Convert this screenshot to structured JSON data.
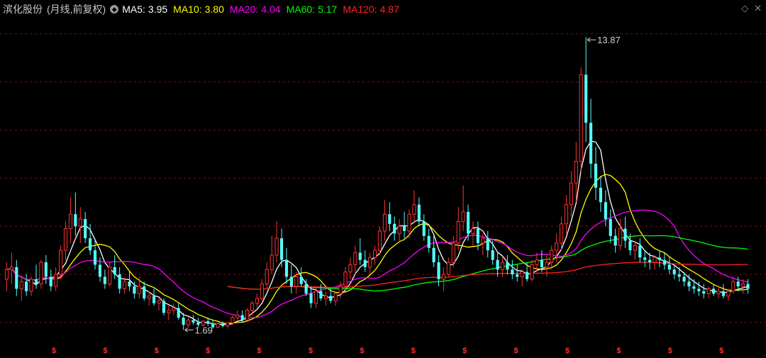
{
  "header": {
    "stock_name": "滨化股份",
    "period": "(月线,前复权)",
    "ma_items": [
      {
        "label": "MA5:",
        "value": "3.95",
        "color": "#ffffff"
      },
      {
        "label": "MA10:",
        "value": "3.80",
        "color": "#ffff00"
      },
      {
        "label": "MA20:",
        "value": "4.04",
        "color": "#ff00ff"
      },
      {
        "label": "MA60:",
        "value": "5.17",
        "color": "#00ff00"
      },
      {
        "label": "MA120:",
        "value": "4.87",
        "color": "#ff2020"
      }
    ],
    "corner_icons": [
      "diamond-icon",
      "close-icon"
    ]
  },
  "chart_data": {
    "type": "candlestick",
    "title": "滨化股份 (月线,前复权)",
    "ylim": [
      1.2,
      14.7
    ],
    "annotations": [
      {
        "text": "13.87",
        "kind": "high"
      },
      {
        "text": "1.69",
        "kind": "low"
      }
    ],
    "colors": {
      "up": "#ff3232",
      "down": "#54ffff",
      "grid": "#7a1010",
      "marker": "#ff3030"
    },
    "marker_label": "$",
    "marker_count": 14,
    "candles": [
      [
        3.8,
        4.5,
        3.3,
        4.2
      ],
      [
        4.2,
        4.9,
        3.6,
        4.3
      ],
      [
        4.3,
        4.6,
        3.1,
        3.4
      ],
      [
        3.4,
        3.9,
        2.9,
        3.7
      ],
      [
        3.7,
        4.0,
        3.1,
        3.3
      ],
      [
        3.3,
        3.9,
        3.1,
        3.8
      ],
      [
        3.8,
        4.4,
        3.4,
        3.6
      ],
      [
        3.6,
        4.6,
        3.4,
        4.5
      ],
      [
        4.5,
        4.8,
        3.6,
        3.9
      ],
      [
        3.9,
        4.2,
        3.3,
        3.5
      ],
      [
        3.5,
        4.3,
        3.3,
        4.0
      ],
      [
        4.0,
        5.2,
        3.8,
        5.0
      ],
      [
        5.0,
        6.2,
        4.6,
        5.9
      ],
      [
        5.9,
        7.2,
        5.3,
        6.5
      ],
      [
        6.5,
        7.4,
        5.6,
        6.0
      ],
      [
        6.0,
        6.8,
        5.3,
        6.3
      ],
      [
        6.3,
        6.6,
        5.3,
        5.5
      ],
      [
        5.5,
        6.1,
        4.8,
        5.0
      ],
      [
        5.0,
        5.4,
        4.2,
        4.4
      ],
      [
        4.4,
        4.7,
        3.7,
        3.9
      ],
      [
        3.9,
        4.2,
        3.4,
        3.6
      ],
      [
        3.6,
        4.5,
        3.5,
        4.3
      ],
      [
        4.3,
        4.8,
        3.8,
        4.0
      ],
      [
        4.0,
        4.3,
        3.2,
        3.4
      ],
      [
        3.4,
        3.9,
        3.2,
        3.7
      ],
      [
        3.7,
        4.1,
        3.3,
        3.5
      ],
      [
        3.5,
        3.7,
        3.0,
        3.2
      ],
      [
        3.2,
        3.9,
        3.0,
        3.5
      ],
      [
        3.5,
        3.7,
        2.9,
        3.0
      ],
      [
        3.0,
        3.3,
        2.7,
        3.1
      ],
      [
        3.1,
        3.4,
        2.7,
        2.8
      ],
      [
        2.8,
        3.0,
        2.5,
        2.9
      ],
      [
        2.9,
        3.0,
        2.3,
        2.4
      ],
      [
        2.4,
        2.7,
        2.1,
        2.5
      ],
      [
        2.5,
        2.8,
        2.3,
        2.6
      ],
      [
        2.6,
        2.8,
        2.1,
        2.2
      ],
      [
        2.2,
        2.4,
        1.69,
        1.9
      ],
      [
        1.9,
        2.2,
        1.8,
        2.1
      ],
      [
        2.1,
        2.3,
        1.9,
        2.0
      ],
      [
        2.0,
        2.2,
        1.8,
        1.9
      ],
      [
        1.9,
        2.1,
        1.8,
        2.05
      ],
      [
        2.05,
        2.2,
        1.85,
        1.95
      ],
      [
        1.95,
        2.1,
        1.75,
        1.8
      ],
      [
        1.8,
        2.0,
        1.75,
        1.95
      ],
      [
        1.95,
        2.05,
        1.8,
        1.85
      ],
      [
        1.85,
        2.0,
        1.75,
        1.98
      ],
      [
        1.98,
        2.3,
        1.9,
        2.2
      ],
      [
        2.2,
        2.5,
        2.1,
        2.3
      ],
      [
        2.3,
        2.5,
        2.0,
        2.1
      ],
      [
        2.1,
        2.6,
        2.0,
        2.5
      ],
      [
        2.5,
        2.9,
        2.3,
        2.8
      ],
      [
        2.8,
        3.2,
        2.6,
        3.0
      ],
      [
        3.0,
        3.8,
        2.9,
        3.6
      ],
      [
        3.6,
        4.5,
        3.4,
        4.2
      ],
      [
        4.2,
        5.6,
        4.0,
        4.8
      ],
      [
        4.8,
        6.2,
        4.5,
        5.5
      ],
      [
        5.5,
        5.9,
        4.3,
        4.6
      ],
      [
        4.6,
        5.1,
        3.6,
        3.9
      ],
      [
        3.9,
        4.4,
        3.2,
        3.5
      ],
      [
        3.5,
        4.1,
        3.2,
        3.9
      ],
      [
        3.9,
        4.3,
        3.5,
        3.6
      ],
      [
        3.6,
        3.8,
        3.1,
        3.2
      ],
      [
        3.2,
        3.5,
        2.6,
        2.8
      ],
      [
        2.8,
        3.5,
        2.6,
        3.3
      ],
      [
        3.3,
        3.6,
        2.9,
        3.0
      ],
      [
        3.0,
        3.3,
        2.7,
        3.1
      ],
      [
        3.1,
        3.4,
        2.8,
        2.9
      ],
      [
        2.9,
        3.3,
        2.7,
        3.2
      ],
      [
        3.2,
        3.7,
        3.0,
        3.5
      ],
      [
        3.5,
        4.3,
        3.3,
        4.1
      ],
      [
        4.1,
        4.7,
        3.8,
        4.4
      ],
      [
        4.4,
        5.2,
        4.0,
        4.9
      ],
      [
        4.9,
        5.5,
        4.4,
        4.6
      ],
      [
        4.6,
        5.0,
        4.1,
        4.3
      ],
      [
        4.3,
        4.9,
        4.0,
        4.7
      ],
      [
        4.7,
        5.2,
        4.4,
        5.0
      ],
      [
        5.0,
        6.0,
        4.8,
        5.8
      ],
      [
        5.8,
        7.1,
        5.4,
        6.5
      ],
      [
        6.5,
        7.0,
        5.8,
        6.1
      ],
      [
        6.1,
        6.4,
        5.4,
        5.7
      ],
      [
        5.7,
        6.3,
        5.3,
        6.0
      ],
      [
        6.0,
        6.6,
        5.5,
        5.8
      ],
      [
        5.8,
        6.7,
        5.5,
        6.5
      ],
      [
        6.5,
        7.5,
        6.1,
        6.9
      ],
      [
        6.9,
        7.2,
        6.0,
        6.2
      ],
      [
        6.2,
        6.5,
        5.4,
        5.6
      ],
      [
        5.6,
        5.9,
        4.9,
        5.1
      ],
      [
        5.1,
        5.6,
        4.3,
        4.5
      ],
      [
        4.5,
        4.8,
        3.5,
        3.8
      ],
      [
        3.8,
        4.3,
        3.3,
        4.0
      ],
      [
        4.0,
        4.7,
        3.9,
        4.5
      ],
      [
        4.5,
        5.6,
        4.3,
        5.3
      ],
      [
        5.3,
        6.8,
        5.0,
        6.2
      ],
      [
        6.2,
        7.7,
        5.8,
        6.6
      ],
      [
        6.6,
        6.9,
        5.4,
        5.7
      ],
      [
        5.7,
        6.2,
        5.2,
        5.9
      ],
      [
        5.9,
        6.2,
        5.0,
        5.3
      ],
      [
        5.3,
        5.7,
        4.8,
        5.5
      ],
      [
        5.5,
        5.8,
        4.7,
        5.0
      ],
      [
        5.0,
        5.4,
        4.4,
        4.6
      ],
      [
        4.6,
        4.9,
        3.9,
        4.2
      ],
      [
        4.2,
        4.7,
        3.9,
        4.5
      ],
      [
        4.5,
        4.8,
        4.0,
        4.2
      ],
      [
        4.2,
        4.6,
        3.8,
        4.0
      ],
      [
        4.0,
        4.4,
        3.7,
        3.9
      ],
      [
        3.9,
        4.2,
        3.5,
        4.1
      ],
      [
        4.1,
        4.5,
        3.7,
        3.8
      ],
      [
        3.8,
        4.6,
        3.7,
        4.4
      ],
      [
        4.4,
        4.9,
        4.1,
        4.6
      ],
      [
        4.6,
        5.0,
        4.1,
        4.3
      ],
      [
        4.3,
        4.8,
        3.9,
        4.5
      ],
      [
        4.5,
        5.2,
        4.2,
        5.0
      ],
      [
        5.0,
        5.7,
        4.5,
        5.3
      ],
      [
        5.3,
        6.4,
        5.0,
        6.1
      ],
      [
        6.1,
        7.3,
        5.7,
        6.9
      ],
      [
        6.9,
        8.3,
        6.4,
        7.8
      ],
      [
        7.8,
        9.5,
        7.0,
        8.7
      ],
      [
        8.7,
        12.6,
        8.2,
        12.3
      ],
      [
        12.3,
        13.87,
        9.5,
        10.3
      ],
      [
        10.3,
        11.3,
        8.0,
        8.6
      ],
      [
        8.6,
        9.3,
        7.1,
        7.6
      ],
      [
        7.6,
        8.1,
        6.6,
        7.0
      ],
      [
        7.0,
        7.5,
        6.0,
        6.3
      ],
      [
        6.3,
        6.7,
        5.3,
        5.6
      ],
      [
        5.6,
        5.9,
        4.9,
        5.2
      ],
      [
        5.2,
        6.3,
        5.0,
        5.9
      ],
      [
        5.9,
        6.4,
        5.1,
        5.4
      ],
      [
        5.4,
        5.7,
        4.8,
        5.0
      ],
      [
        5.0,
        5.4,
        4.6,
        5.2
      ],
      [
        5.2,
        5.5,
        4.5,
        4.7
      ],
      [
        4.7,
        5.0,
        4.3,
        4.6
      ],
      [
        4.6,
        4.9,
        4.2,
        4.5
      ],
      [
        4.5,
        4.8,
        4.2,
        4.7
      ],
      [
        4.7,
        5.0,
        4.3,
        4.6
      ],
      [
        4.6,
        4.9,
        4.2,
        4.4
      ],
      [
        4.4,
        4.7,
        4.0,
        4.2
      ],
      [
        4.2,
        4.4,
        3.8,
        4.0
      ],
      [
        4.0,
        4.3,
        3.7,
        3.9
      ],
      [
        3.9,
        4.1,
        3.5,
        3.7
      ],
      [
        3.7,
        4.0,
        3.3,
        3.5
      ],
      [
        3.5,
        3.8,
        3.2,
        3.4
      ],
      [
        3.4,
        3.7,
        3.1,
        3.3
      ],
      [
        3.3,
        3.6,
        3.0,
        3.2
      ],
      [
        3.2,
        3.5,
        3.0,
        3.4
      ],
      [
        3.4,
        3.6,
        3.1,
        3.2
      ],
      [
        3.2,
        3.5,
        3.0,
        3.3
      ],
      [
        3.3,
        3.6,
        3.0,
        3.1
      ],
      [
        3.1,
        3.4,
        2.9,
        3.3
      ],
      [
        3.3,
        3.9,
        3.2,
        3.7
      ],
      [
        3.7,
        3.9,
        3.3,
        3.5
      ],
      [
        3.5,
        3.8,
        3.2,
        3.6
      ],
      [
        3.6,
        3.8,
        3.2,
        3.4
      ]
    ],
    "series": [
      {
        "name": "MA5",
        "period": 5,
        "color": "#ffffff"
      },
      {
        "name": "MA10",
        "period": 10,
        "color": "#ffff00"
      },
      {
        "name": "MA20",
        "period": 20,
        "color": "#ff00ff"
      },
      {
        "name": "MA60",
        "period": 60,
        "color": "#00ff00"
      },
      {
        "name": "MA120",
        "period": 120,
        "color": "#ff2020"
      }
    ],
    "grid": true
  }
}
